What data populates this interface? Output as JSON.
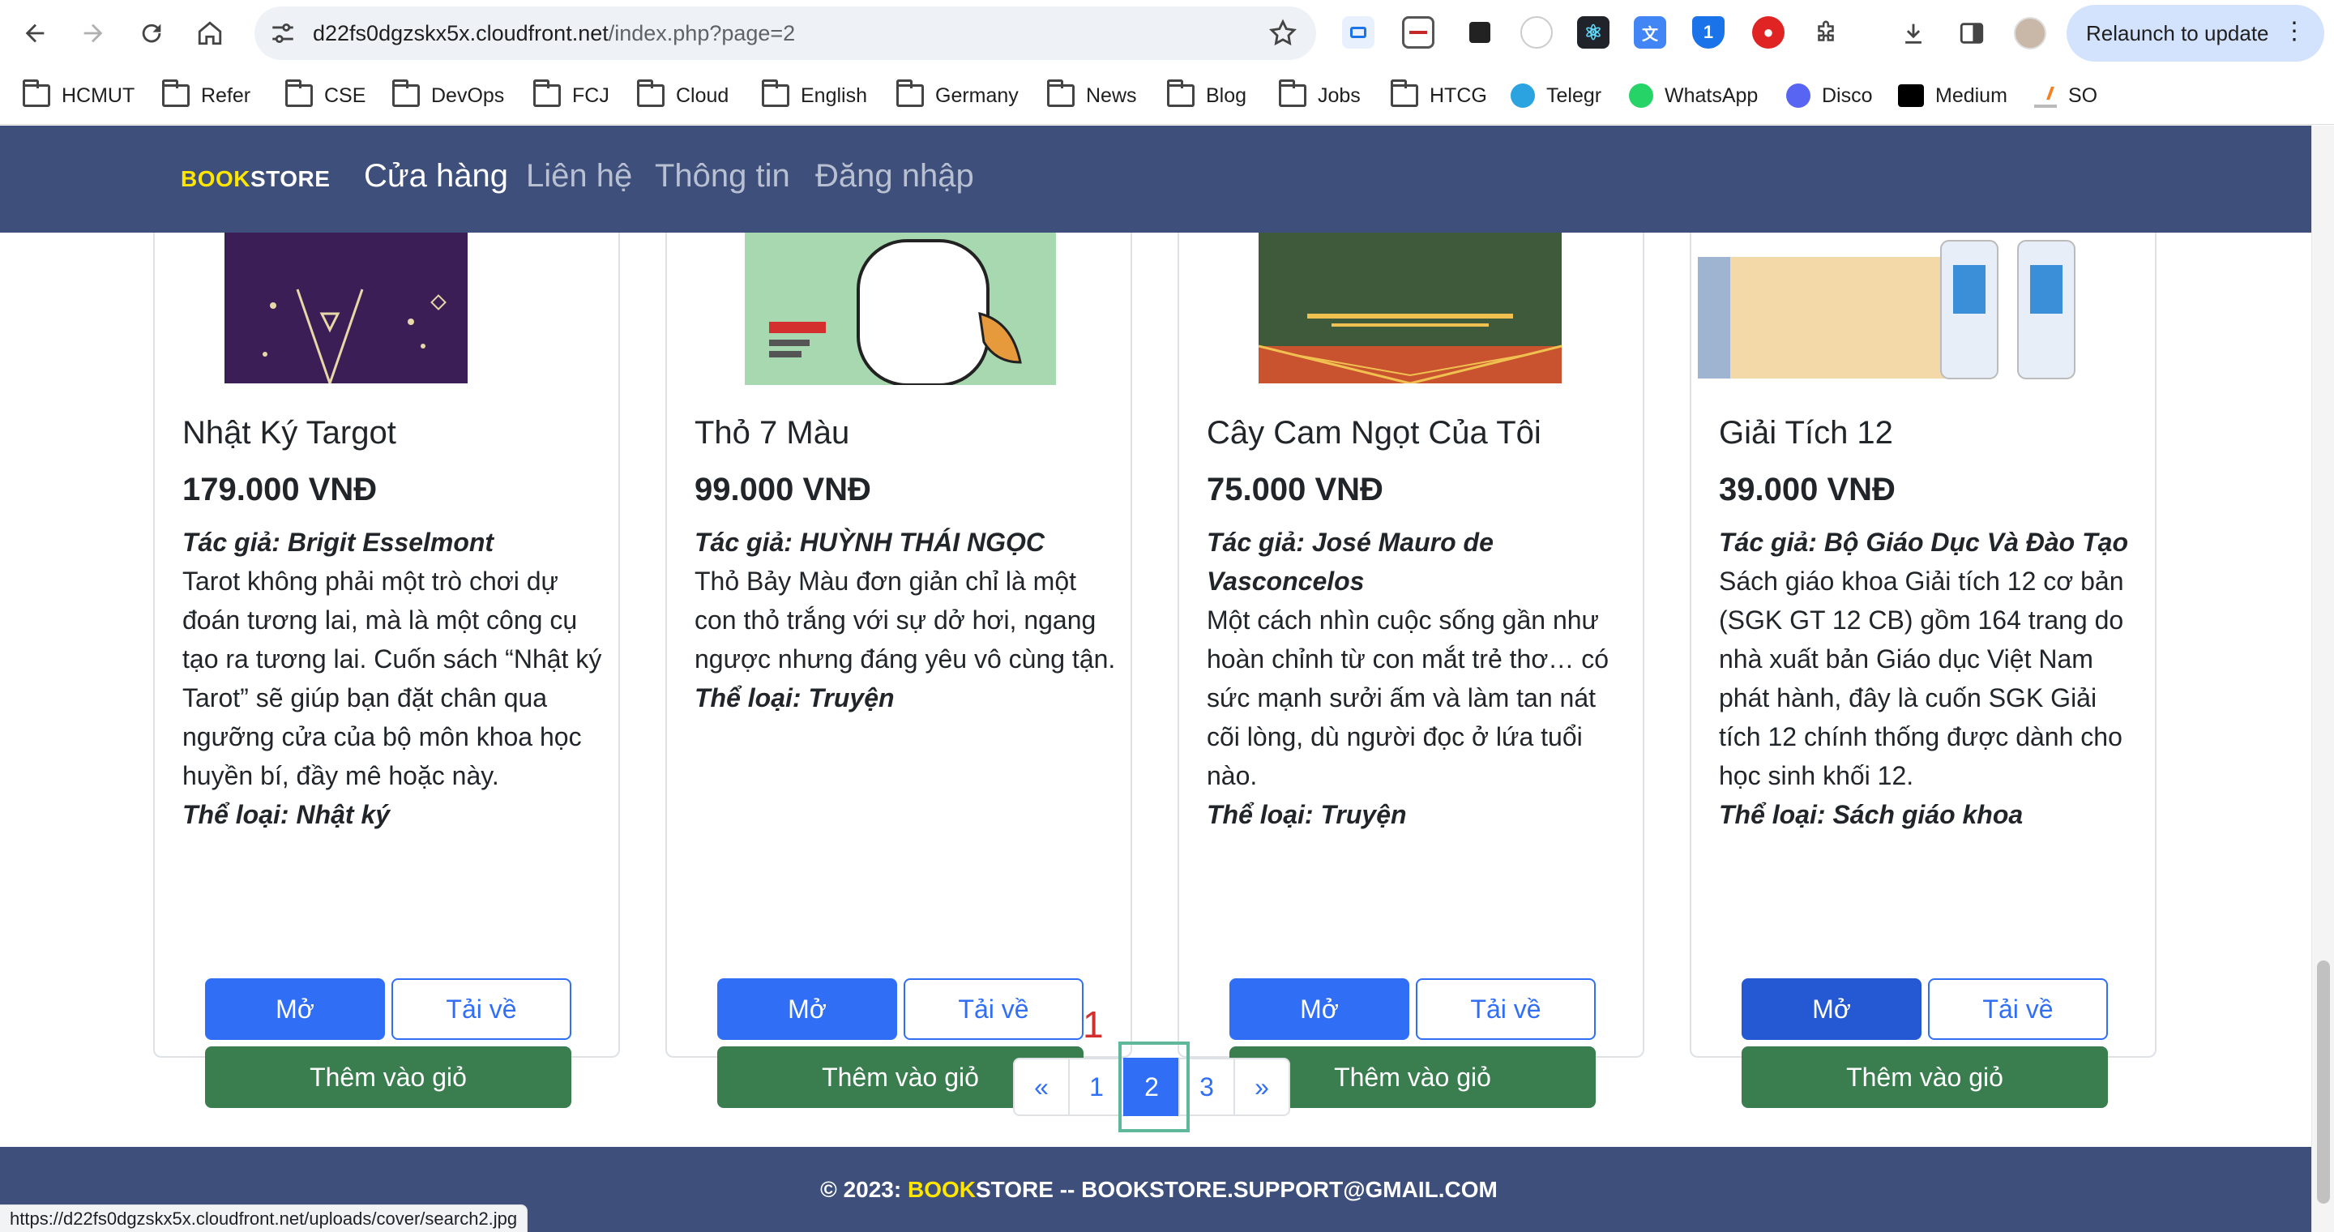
{
  "browser": {
    "url_host": "d22fs0dgzskx5x.cloudfront.net",
    "url_path": "/index.php?page=2",
    "relaunch_label": "Relaunch to update",
    "bookmarks": [
      "HCMUT",
      "Refer",
      "CSE",
      "DevOps",
      "FCJ",
      "Cloud",
      "English",
      "Germany",
      "News",
      "Blog",
      "Jobs",
      "HTCG",
      "Telegr",
      "WhatsApp",
      "Disco",
      "Medium",
      "SO"
    ],
    "status_url": "https://d22fs0dgzskx5x.cloudfront.net/uploads/cover/search2.jpg"
  },
  "navbar": {
    "brand_book": "BOOK",
    "brand_store": "STORE",
    "links": [
      "Cửa hàng",
      "Liên hệ",
      "Thông tin",
      "Đăng nhập"
    ]
  },
  "products": [
    {
      "title": "Nhật Ký Targot",
      "price": "179.000 VNĐ",
      "author": "Tác giả: Brigit Esselmont",
      "description": "Tarot không phải một trò chơi dự đoán tương lai, mà là một công cụ tạo ra tương lai. Cuốn sách “Nhật ký Tarot” sẽ giúp bạn đặt chân qua ngưỡng cửa của bộ môn khoa học huyền bí, đầy mê hoặc này.",
      "category": "Thể loại: Nhật ký"
    },
    {
      "title": "Thỏ 7 Màu",
      "price": "99.000 VNĐ",
      "author": "Tác giả: HUỲNH THÁI NGỌC",
      "description": "Thỏ Bảy Màu đơn giản chỉ là một con thỏ trắng với sự dở hơi, ngang ngược nhưng đáng yêu vô cùng tận.",
      "category": "Thể loại: Truyện"
    },
    {
      "title": "Cây Cam Ngọt Của Tôi",
      "price": "75.000 VNĐ",
      "author": "Tác giả: José Mauro de Vasconcelos",
      "description": "Một cách nhìn cuộc sống gần như hoàn chỉnh từ con mắt trẻ thơ… có sức mạnh sưởi ấm và làm tan nát cõi lòng, dù người đọc ở lứa tuổi nào.",
      "category": "Thể loại: Truyện"
    },
    {
      "title": "Giải Tích 12",
      "price": "39.000 VNĐ",
      "author": "Tác giả: Bộ Giáo Dục Và Đào Tạo",
      "description": "Sách giáo khoa Giải tích 12 cơ bản (SGK GT 12 CB) gồm 164 trang do nhà xuất bản Giáo dục Việt Nam phát hành, đây là cuốn SGK Giải tích 12 chính thống được dành cho học sinh khối 12.",
      "category": "Thể loại: Sách giáo khoa"
    }
  ],
  "buttons": {
    "open": "Mở",
    "download": "Tải về",
    "add_to_cart": "Thêm vào giỏ"
  },
  "pagination": {
    "prev": "«",
    "pages": [
      "1",
      "2",
      "3"
    ],
    "next": "»",
    "current": "2"
  },
  "annotation": "1",
  "footer": {
    "prefix": "© 2023: ",
    "brand_book": "BOOK",
    "rest": "STORE -- BOOKSTORE.SUPPORT@GMAIL.COM"
  }
}
